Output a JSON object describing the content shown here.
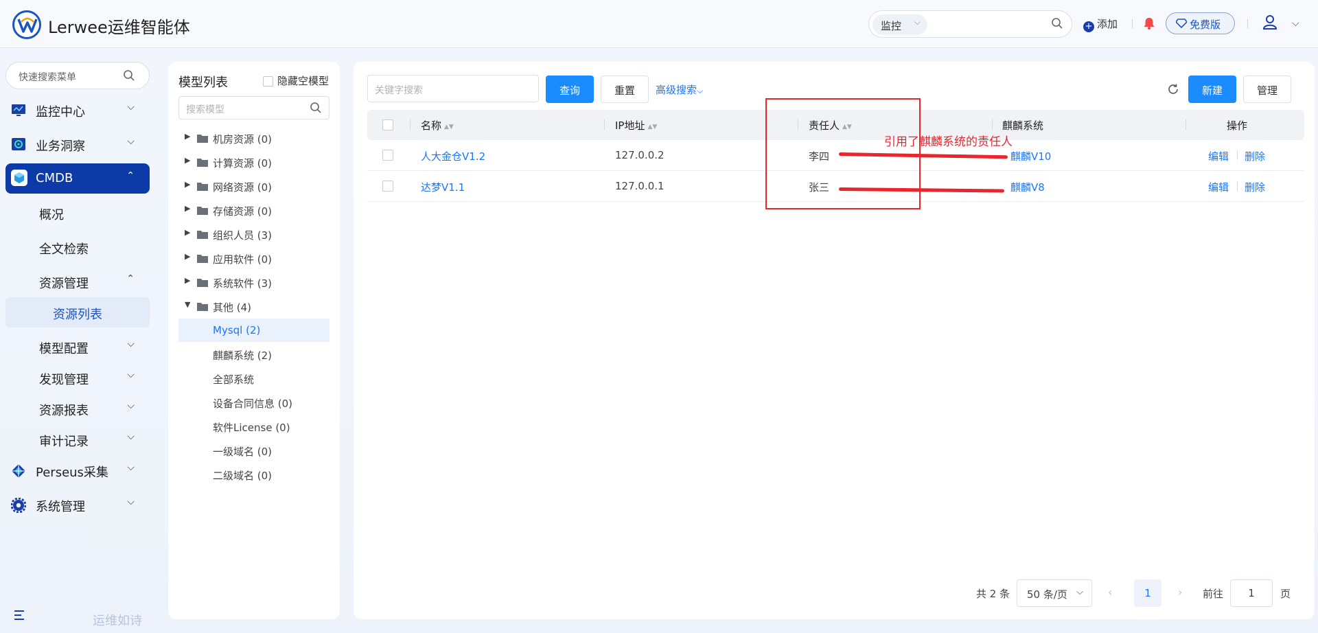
{
  "app": {
    "title": "Lerwee运维智能体"
  },
  "header": {
    "search_scope": "监控",
    "add_label": "添加",
    "free_label": "免费版"
  },
  "sidebar": {
    "search_placeholder": "快速搜索菜单",
    "items": [
      {
        "label": "监控中心",
        "icon": "monitor-icon"
      },
      {
        "label": "业务洞察",
        "icon": "insight-icon"
      },
      {
        "label": "CMDB",
        "icon": "cube-icon"
      }
    ],
    "cmdb_sub": [
      {
        "label": "概况"
      },
      {
        "label": "全文检索"
      },
      {
        "label": "资源管理"
      }
    ],
    "resource_sub_active": "资源列表",
    "cmdb_sub2": [
      {
        "label": "模型配置"
      },
      {
        "label": "发现管理"
      },
      {
        "label": "资源报表"
      },
      {
        "label": "审计记录"
      }
    ],
    "bottom_items": [
      {
        "label": "Perseus采集",
        "icon": "diamond-grid-icon"
      },
      {
        "label": "系统管理",
        "icon": "gear-icon"
      }
    ],
    "footer_text": "运维如诗"
  },
  "model_list": {
    "title": "模型列表",
    "hide_empty_label": "隐藏空模型",
    "search_placeholder": "搜索模型",
    "groups": [
      {
        "label": "机房资源 (0)"
      },
      {
        "label": "计算资源 (0)"
      },
      {
        "label": "网络资源 (0)"
      },
      {
        "label": "存储资源 (0)"
      },
      {
        "label": "组织人员 (3)"
      },
      {
        "label": "应用软件 (0)"
      },
      {
        "label": "系统软件 (3)"
      },
      {
        "label": "其他 (4)"
      }
    ],
    "leaves": [
      {
        "label": "Mysql (2)"
      },
      {
        "label": "麒麟系统 (2)"
      },
      {
        "label": "全部系统"
      },
      {
        "label": "设备合同信息 (0)"
      },
      {
        "label": "软件License (0)"
      },
      {
        "label": "一级域名 (0)"
      },
      {
        "label": "二级域名 (0)"
      }
    ]
  },
  "toolbar": {
    "keyword_placeholder": "关键字搜索",
    "query_label": "查询",
    "reset_label": "重置",
    "advanced_label": "高级搜索",
    "new_label": "新建",
    "manage_label": "管理"
  },
  "table": {
    "columns": [
      "名称",
      "IP地址",
      "责任人",
      "麒麟系统",
      "操作"
    ],
    "rows": [
      {
        "name": "人大金仓V1.2",
        "ip": "127.0.0.2",
        "owner": "李四",
        "system": "麒麟V10",
        "edit": "编辑",
        "delete": "删除"
      },
      {
        "name": "达梦V1.1",
        "ip": "127.0.0.1",
        "owner": "张三",
        "system": "麒麟V8",
        "edit": "编辑",
        "delete": "删除"
      }
    ]
  },
  "annotation": {
    "text": "引用了麒麟系统的责任人",
    "color": "#e8262c"
  },
  "pagination": {
    "total": "共 2 条",
    "page_size": "50 条/页",
    "current_page": "1",
    "goto_label": "前往",
    "goto_value": "1",
    "page_suffix": "页"
  },
  "colors": {
    "primary": "#1a8cff",
    "nav_active": "#0c3aa7",
    "link": "#1a75ff"
  }
}
